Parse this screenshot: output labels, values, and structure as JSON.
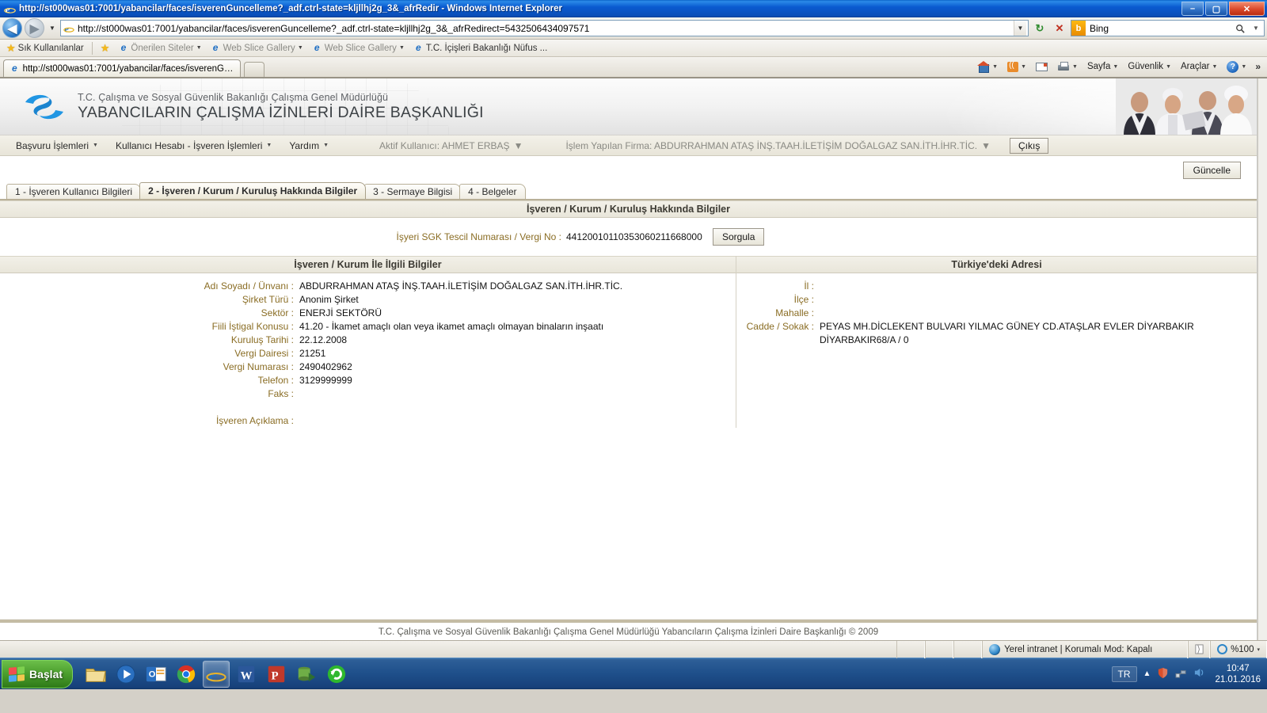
{
  "window": {
    "title": "http://st000was01:7001/yabancilar/faces/isverenGuncelleme?_adf.ctrl-state=kljllhj2g_3&_afrRedir - Windows Internet Explorer",
    "minimize": "–",
    "maximize": "▢",
    "close": "✕"
  },
  "browser": {
    "url": "http://st000was01:7001/yabancilar/faces/isverenGuncelleme?_adf.ctrl-state=kljllhj2g_3&_afrRedirect=5432506434097571",
    "back_glyph": "◀",
    "forward_glyph": "▶",
    "refresh_glyph": "↻",
    "stop_glyph": "✕",
    "search_value": "Bing",
    "search_engine_letter": "b",
    "go_glyph": "🔍",
    "dropdown_glyph": "▼",
    "favorites": {
      "main_label": "Sık Kullanılanlar",
      "items": [
        {
          "label": "Önerilen Siteler",
          "dim": true,
          "caret": true
        },
        {
          "label": "Web Slice Gallery",
          "dim": true,
          "caret": true
        },
        {
          "label": "Web Slice Gallery",
          "dim": true,
          "caret": true
        },
        {
          "label": "T.C. İçişleri Bakanlığı Nüfus ...",
          "dim": false,
          "caret": false
        }
      ]
    },
    "tab": {
      "label": "http://st000was01:7001/yabancilar/faces/isverenGun..."
    },
    "commands": [
      {
        "name": "home",
        "label": "",
        "caret": true
      },
      {
        "name": "feeds",
        "label": "",
        "caret": true
      },
      {
        "name": "mail",
        "label": "",
        "caret": false
      },
      {
        "name": "print",
        "label": "",
        "caret": true
      },
      {
        "name": "page",
        "label": "Sayfa",
        "caret": true
      },
      {
        "name": "safety",
        "label": "Güvenlik",
        "caret": true
      },
      {
        "name": "tools",
        "label": "Araçlar",
        "caret": true
      },
      {
        "name": "help",
        "label": "",
        "caret": true
      }
    ],
    "overflow_glyph": "»"
  },
  "site": {
    "ministry_line": "T.C. Çalışma ve Sosyal Güvenlik Bakanlığı Çalışma Genel Müdürlüğü",
    "department_line": "YABANCILARIN ÇALIŞMA İZİNLERİ DAİRE BAŞKANLIĞI",
    "menu": [
      {
        "label": "Başvuru İşlemleri",
        "caret": true
      },
      {
        "label": "Kullanıcı Hesabı - İşveren İşlemleri",
        "caret": true
      },
      {
        "label": "Yardım",
        "caret": true
      }
    ],
    "active_user": "Aktif Kullanıcı: AHMET ERBAŞ",
    "active_firm": "İşlem Yapılan Firma: ABDURRAHMAN ATAŞ İNŞ.TAAH.İLETİŞİM DOĞALGAZ SAN.İTH.İHR.TİC.",
    "logout_label": "Çıkış",
    "update_label": "Güncelle",
    "footer": "T.C. Çalışma ve Sosyal Güvenlik Bakanlığı Çalışma Genel Müdürlüğü Yabancıların Çalışma İzinleri Daire Başkanlığı © 2009"
  },
  "wizard": {
    "tabs": [
      {
        "label": "1 - İşveren Kullanıcı Bilgileri",
        "active": false
      },
      {
        "label": "2 - İşveren / Kurum / Kuruluş Hakkında Bilgiler",
        "active": true
      },
      {
        "label": "3 - Sermaye Bilgisi",
        "active": false
      },
      {
        "label": "4 - Belgeler",
        "active": false
      }
    ]
  },
  "content": {
    "section_title": "İşveren / Kurum / Kuruluş Hakkında Bilgiler",
    "query": {
      "label": "İşyeri SGK Tescil Numarası / Vergi No :",
      "value": "44120010110353060211668000",
      "button": "Sorgula"
    },
    "left_panel": {
      "title": "İşveren / Kurum İle İlgili Bilgiler",
      "rows": [
        {
          "label": "Adı Soyadı / Ünvanı :",
          "value": "ABDURRAHMAN ATAŞ İNŞ.TAAH.İLETİŞİM DOĞALGAZ SAN.İTH.İHR.TİC."
        },
        {
          "label": "Şirket Türü :",
          "value": "Anonim Şirket"
        },
        {
          "label": "Sektör :",
          "value": "ENERJİ SEKTÖRÜ"
        },
        {
          "label": "Fiili İştigal Konusu :",
          "value": "41.20 - İkamet amaçlı olan veya ikamet amaçlı olmayan binaların inşaatı"
        },
        {
          "label": "Kuruluş Tarihi :",
          "value": "22.12.2008"
        },
        {
          "label": "Vergi Dairesi :",
          "value": "21251"
        },
        {
          "label": "Vergi Numarası :",
          "value": "2490402962"
        },
        {
          "label": "Telefon :",
          "value": "3129999999"
        },
        {
          "label": "Faks :",
          "value": ""
        }
      ],
      "description_label": "İşveren Açıklama :",
      "description_value": ""
    },
    "right_panel": {
      "title": "Türkiye'deki Adresi",
      "rows": [
        {
          "label": "İl :",
          "value": ""
        },
        {
          "label": "İlçe :",
          "value": ""
        },
        {
          "label": "Mahalle :",
          "value": ""
        },
        {
          "label": "Cadde / Sokak :",
          "value": "PEYAS MH.DİCLEKENT BULVARI YILMAC GÜNEY CD.ATAŞLAR EVLER DİYARBAKIR DİYARBAKIR68/A / 0"
        }
      ]
    }
  },
  "statusbar": {
    "zone": "Yerel intranet | Korumalı Mod: Kapalı",
    "zoom": "%100",
    "zoom_caret": "▾"
  },
  "taskbar": {
    "start_label": "Başlat",
    "apps": [
      {
        "name": "explorer",
        "active": false
      },
      {
        "name": "media-player",
        "active": false
      },
      {
        "name": "outlook",
        "active": false
      },
      {
        "name": "chrome",
        "active": false
      },
      {
        "name": "internet-explorer",
        "active": true
      },
      {
        "name": "word",
        "active": false
      },
      {
        "name": "powerpoint",
        "active": false
      },
      {
        "name": "database-tool",
        "active": false
      },
      {
        "name": "sync-tool",
        "active": false
      }
    ],
    "language": "TR",
    "time": "10:47",
    "date": "21.01.2016"
  },
  "colors": {
    "label_brown": "#8a6d24",
    "accent_blue": "#1f72c8",
    "panel_header": "#f0ede3"
  }
}
